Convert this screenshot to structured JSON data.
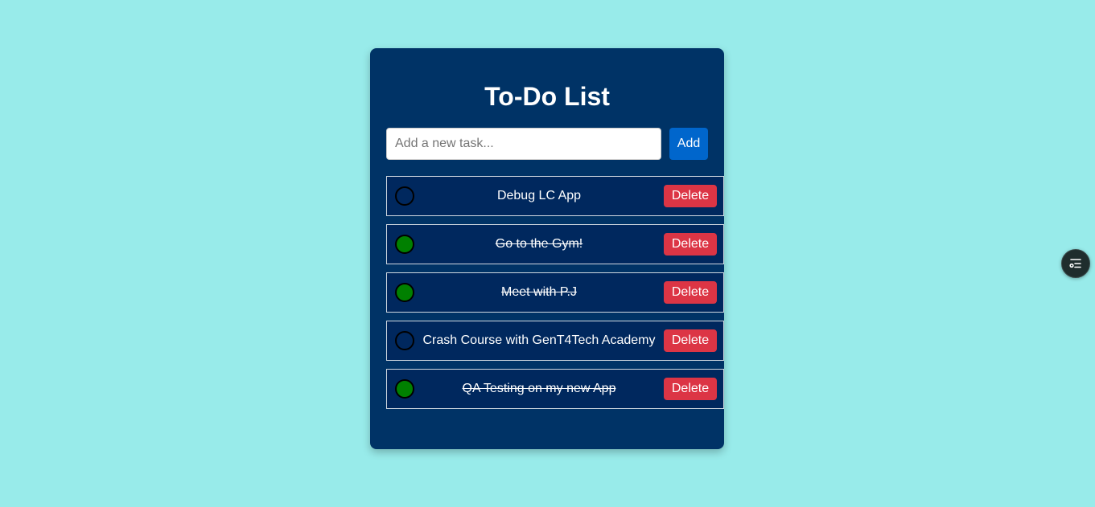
{
  "app": {
    "title": "To-Do List"
  },
  "input": {
    "placeholder": "Add a new task...",
    "value": ""
  },
  "add_button": {
    "label": "Add"
  },
  "tasks": [
    {
      "text": "Debug LC App",
      "completed": false,
      "delete_label": "Delete"
    },
    {
      "text": "Go to the Gym!",
      "completed": true,
      "delete_label": "Delete"
    },
    {
      "text": "Meet with P.J",
      "completed": true,
      "delete_label": "Delete"
    },
    {
      "text": "Crash Course with GenT4Tech Academy",
      "completed": false,
      "delete_label": "Delete"
    },
    {
      "text": "QA Testing on my new App",
      "completed": true,
      "delete_label": "Delete"
    }
  ],
  "colors": {
    "page_background": "#98ebea",
    "card_background": "#003366",
    "add_button": "#0066cc",
    "delete_button": "#dc3545",
    "completed_check": "#008000"
  },
  "floating_widget": {
    "icon": "tasks-toggle-icon"
  }
}
